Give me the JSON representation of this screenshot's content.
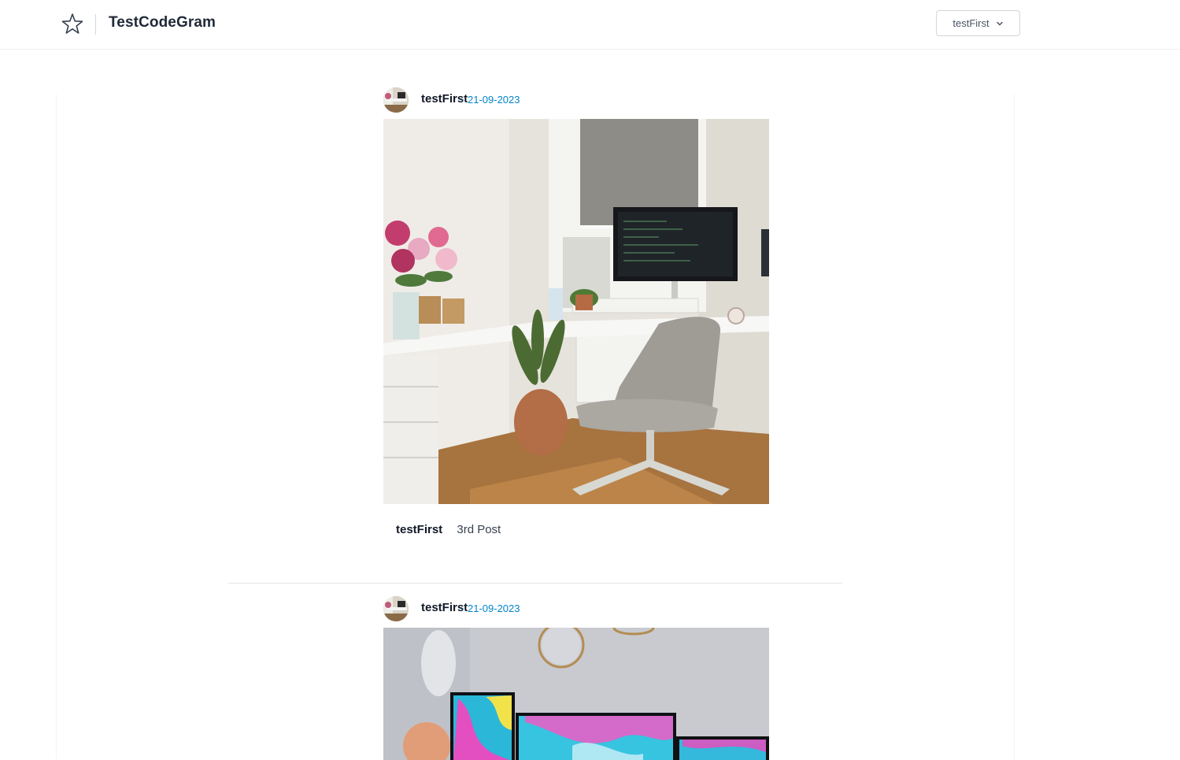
{
  "app": {
    "brand_name": "TestCodeGram",
    "logo_icon": "star-outline-icon"
  },
  "user_menu": {
    "label": "testFirst",
    "icon": "chevron-down-icon"
  },
  "posts": [
    {
      "author": "testFirst",
      "separator": "·",
      "date": "21-09-2023",
      "image_desc": "desk-setup-photo",
      "caption_user": "testFirst",
      "caption_text": "3rd Post"
    },
    {
      "author": "testFirst",
      "separator": "·",
      "date": "21-09-2023",
      "image_desc": "monitors-setup-photo"
    }
  ],
  "colors": {
    "date": "#0284c7",
    "border": "#e5e7eb"
  }
}
